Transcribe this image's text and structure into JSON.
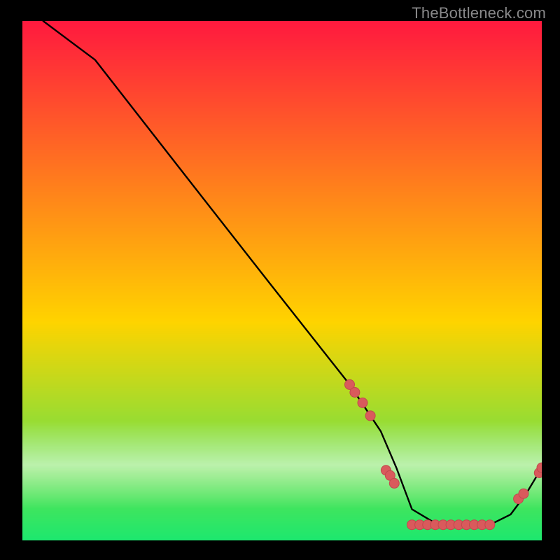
{
  "watermark": "TheBottleneck.com",
  "colors": {
    "bg": "#000000",
    "grad_top": "#ff1a3f",
    "grad_mid": "#ffd400",
    "grad_bot": "#1ee86f",
    "curve": "#000000",
    "marker_fill": "#d95a5c",
    "marker_stroke": "#c14a4d"
  },
  "chart_data": {
    "type": "line",
    "title": "",
    "xlabel": "",
    "ylabel": "",
    "xlim": [
      0,
      100
    ],
    "ylim": [
      0,
      100
    ],
    "curve": {
      "x": [
        4,
        8,
        14,
        30,
        48,
        63,
        69,
        72,
        75,
        80,
        85,
        90,
        94,
        97,
        100
      ],
      "y": [
        100,
        97,
        92.5,
        72,
        49,
        30,
        21,
        14,
        6,
        3,
        3,
        3,
        5,
        9,
        14
      ]
    },
    "markers": [
      {
        "x": 63,
        "y": 30
      },
      {
        "x": 64,
        "y": 28.5
      },
      {
        "x": 65.5,
        "y": 26.5
      },
      {
        "x": 67,
        "y": 24
      },
      {
        "x": 70,
        "y": 13.5
      },
      {
        "x": 70.8,
        "y": 12.5
      },
      {
        "x": 71.6,
        "y": 11
      },
      {
        "x": 75,
        "y": 3
      },
      {
        "x": 76.5,
        "y": 3
      },
      {
        "x": 78,
        "y": 3
      },
      {
        "x": 79.5,
        "y": 3
      },
      {
        "x": 81,
        "y": 3
      },
      {
        "x": 82.5,
        "y": 3
      },
      {
        "x": 84,
        "y": 3
      },
      {
        "x": 85.5,
        "y": 3
      },
      {
        "x": 87,
        "y": 3
      },
      {
        "x": 88.5,
        "y": 3
      },
      {
        "x": 90,
        "y": 3
      },
      {
        "x": 95.5,
        "y": 8
      },
      {
        "x": 96.5,
        "y": 9
      },
      {
        "x": 99.5,
        "y": 13
      },
      {
        "x": 100,
        "y": 14
      }
    ]
  }
}
